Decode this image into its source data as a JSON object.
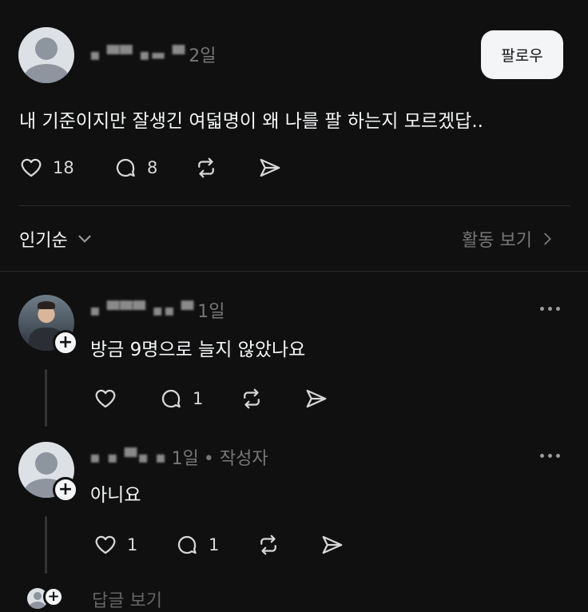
{
  "post": {
    "author_masked": "▪ ▀▀ ▪▬ ▀",
    "time": "2일",
    "follow_label": "팔로우",
    "text": "내 기준이지만 잘생긴 여덟명이 왜 나를 팔 하는지 모르겠답..",
    "likes": "18",
    "comments": "8"
  },
  "sort": {
    "label": "인기순",
    "activity_label": "활동 보기"
  },
  "replies": [
    {
      "author_masked": "▪ ▀▀▀ ▪▪ ▀",
      "time": "1일",
      "author_badge": "",
      "text": "방금 9명으로 늘지 않았나요",
      "likes": "",
      "comments": "1"
    },
    {
      "author_masked": "▪ ▪ ▀▪ ▪",
      "time": "1일",
      "author_badge": "• 작성자",
      "text": "아니요",
      "likes": "1",
      "comments": "1"
    }
  ],
  "more_replies_label": "답글 보기",
  "colors": {
    "background": "#101010",
    "text": "#f3f5f7",
    "muted": "#777777",
    "button_bg": "#f3f5f7"
  }
}
